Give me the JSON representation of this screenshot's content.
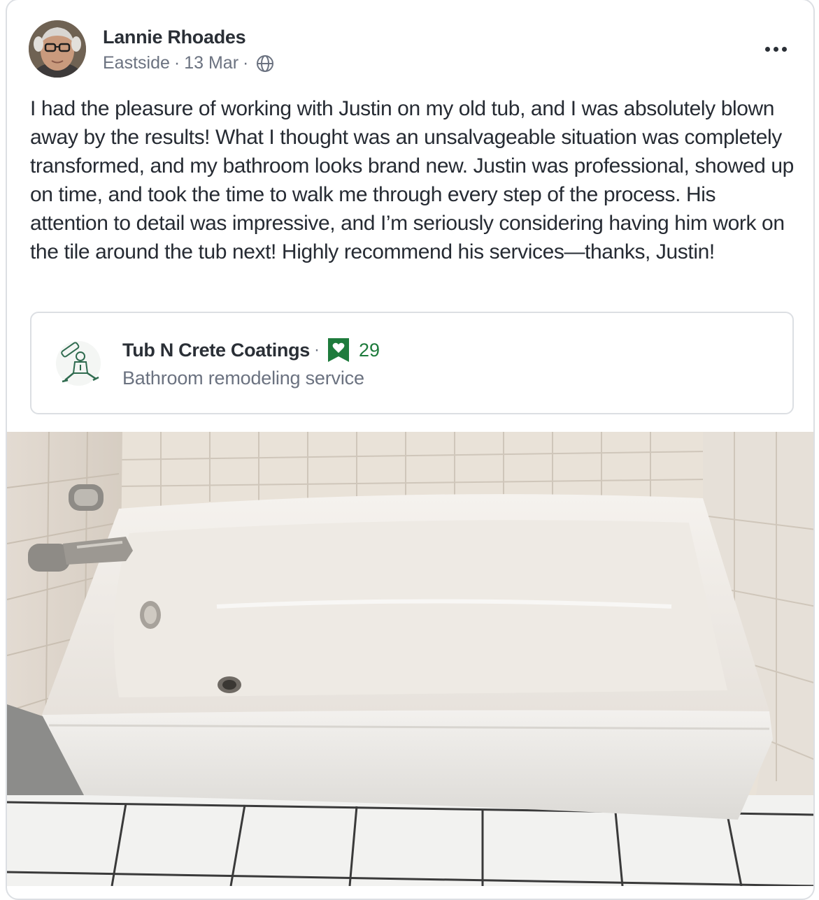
{
  "post": {
    "author": "Lannie Rhoades",
    "neighborhood": "Eastside",
    "date": "13 Mar",
    "separator": "·",
    "visibility_icon": "globe-icon",
    "more_icon": "more-options-icon",
    "text": "I had the pleasure of working with Justin on my old tub, and I was absolutely blown away by the results! What I thought was an unsalvageable situation was completely transformed, and my bathroom looks brand new. Justin was professional, showed up on time, and took the time to walk me through every step of the process. His attention to detail was impressive, and I’m seriously considering having him work on the tile around the tub next! Highly recommend his services—thanks, Justin!"
  },
  "business": {
    "name": "Tub N Crete Coatings",
    "separator": "·",
    "favorite_icon": "heart-bookmark-icon",
    "favorite_count": "29",
    "category": "Bathroom remodeling service"
  },
  "colors": {
    "accent_green": "#1e7b3c",
    "muted_text": "#6b7280",
    "border": "#dcdfe3"
  }
}
